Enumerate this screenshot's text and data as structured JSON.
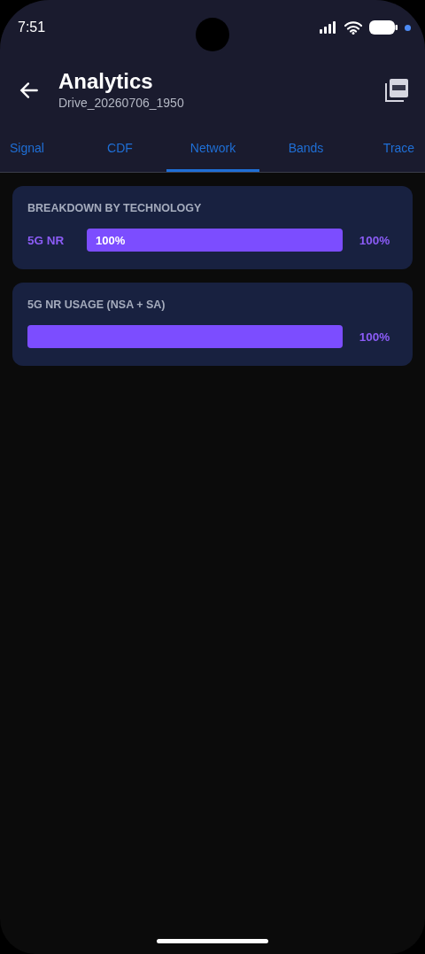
{
  "status_bar": {
    "time": "7:51"
  },
  "header": {
    "title": "Analytics",
    "subtitle": "Drive_20260706_1950"
  },
  "tabs": [
    {
      "label": "Signal",
      "selected": false
    },
    {
      "label": "CDF",
      "selected": false
    },
    {
      "label": "Network",
      "selected": true
    },
    {
      "label": "Bands",
      "selected": false
    },
    {
      "label": "Trace",
      "selected": false
    }
  ],
  "cards": [
    {
      "title": "BREAKDOWN BY TECHNOLOGY",
      "rows": [
        {
          "label": "5G NR",
          "level": 1.0,
          "inner_value": "100%",
          "value": "100%"
        }
      ]
    },
    {
      "title": "5G NR USAGE (NSA + SA)",
      "rows": [
        {
          "level": 1.0,
          "value": "100%"
        }
      ]
    }
  ]
}
